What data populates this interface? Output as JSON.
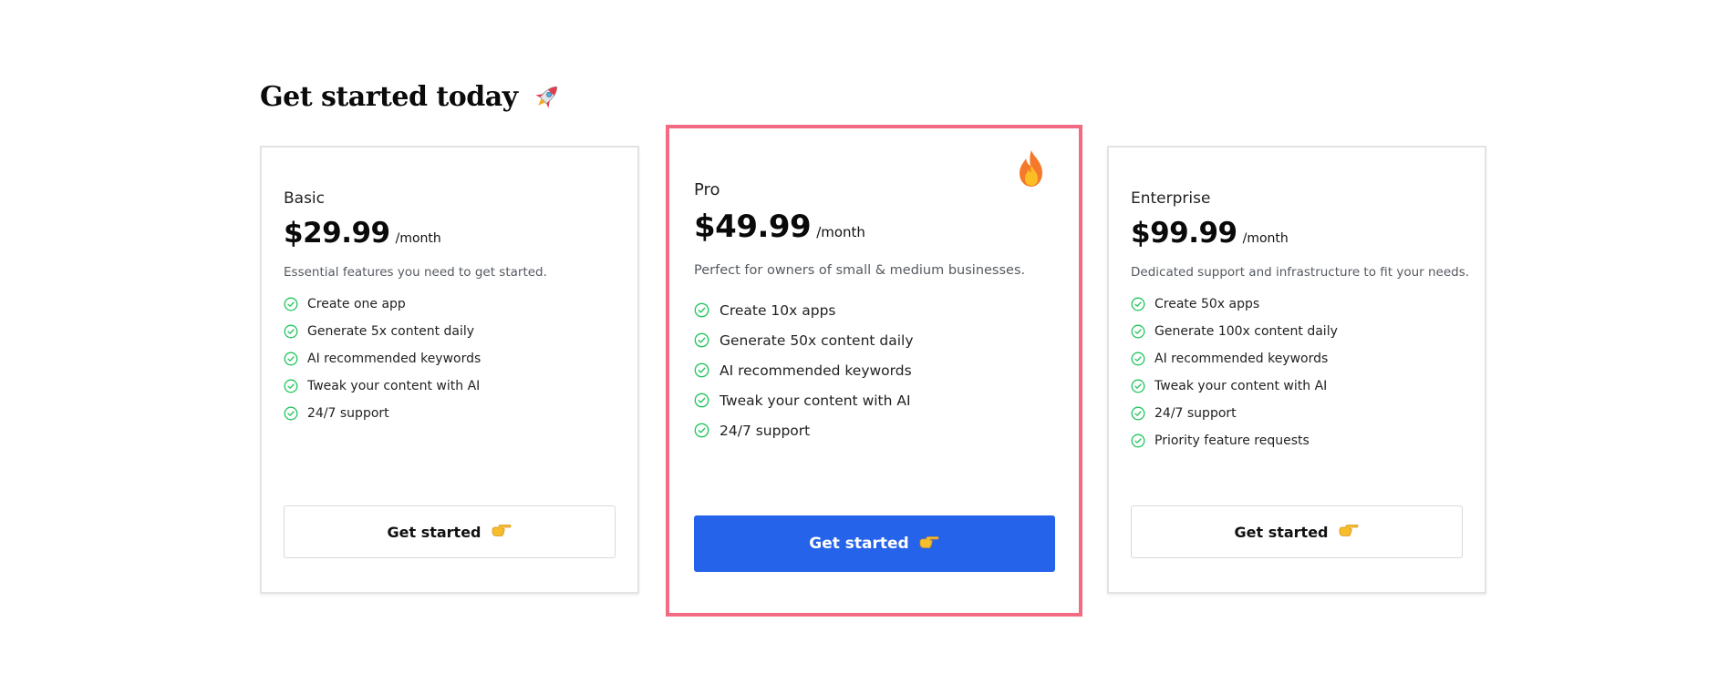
{
  "header": {
    "title": "Get started today",
    "title_icon": "rocket-icon"
  },
  "plans": [
    {
      "name": "Basic",
      "price": "$29.99",
      "period": "/month",
      "description": "Essential features you need to get started.",
      "features": [
        "Create one app",
        "Generate 5x content daily",
        "AI recommended keywords",
        "Tweak your content with AI",
        "24/7 support"
      ],
      "button_label": "Get started",
      "button_icon": "pointing-hand-icon"
    },
    {
      "name": "Pro",
      "price": "$49.99",
      "period": "/month",
      "description": "Perfect for owners of small & medium businesses.",
      "features": [
        "Create 10x apps",
        "Generate 50x content daily",
        "AI recommended keywords",
        "Tweak your content with AI",
        "24/7 support"
      ],
      "button_label": "Get started",
      "button_icon": "pointing-hand-icon",
      "badge_icon": "fire-icon",
      "highlighted": true
    },
    {
      "name": "Enterprise",
      "price": "$99.99",
      "period": "/month",
      "description": "Dedicated support and infrastructure to fit your needs.",
      "features": [
        "Create 50x apps",
        "Generate 100x content daily",
        "AI recommended keywords",
        "Tweak your content with AI",
        "24/7 support",
        "Priority feature requests"
      ],
      "button_label": "Get started",
      "button_icon": "pointing-hand-icon"
    }
  ],
  "colors": {
    "primary_button": "#2563eb",
    "highlight_border": "#f26b83",
    "check": "#22c55e"
  }
}
